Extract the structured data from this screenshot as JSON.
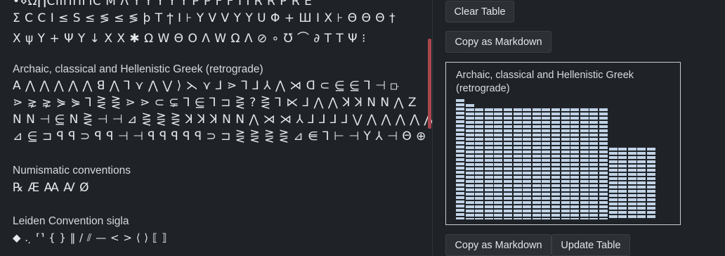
{
  "glyph_lines": [
    "•⋄Ω∏CIIΠΠΓIC M Λ Y Y Y Y Y P P F F I I R R P R E",
    "Σ C Ⅽ I ≤ S ≤ ≶ ≤ ≶ ϸ T ϯ I ⊦ Y V V Y Y U Φ + Ш I X ⊦ Θ Θ Θ †",
    "X ψ Y + Ψ Y ↓ X X ✱ Ω W Θ O Λ W Ω Λ ⊘ ∘ Ʊ ⌒ ∂ T T Ψ ⁝"
  ],
  "sections": [
    {
      "title": "Archaic, classical and Hellenistic Greek (retrograde)",
      "lines": [
        "ꓮ ⋀ ⋀ ⋀ ⋀ ⋀ ꓭ ⋀ ⅂ ⋎ ⋀ ⋁ ⟩ ⋋ ⋎ ⅃ ⋗ ⅂ ⅃ ⅄ ⋀ ⋊ ꓷ ⊂ ⋸ ⋸ ⅂ ⊣ ⟥",
        "⋗ ⋧ ⋧ ⋟ ⋟ ⅂ ⋛ ⋛ ⋗ ⋗ ⊂ ⊊ ⅂ ⋸ ⅂ ⊐ ⋛ ? ⋛ ⅂ ⋉ ⅃ ⋀ ⋀ ꓘ ꓘ ꓠ ꓠ ⋀ Z",
        "ꓠ ꓠ ⊣ ⋸ ꓠ ⋛ ⊣ ⊣ ⊿ ⋛ ⋛ ⋛ ꓘ ꓘ ꓘ ꓠ ꓠ ⋀ ⋊ ⋊ ⅄ ⅃ ⅃ ⅃ ⅃ ⋁ ⋀ ⋀ ⋀ ⋀ ⋀",
        "⊿ ⋸ ⊐ ꟼ ꟼ ⊃ ꟼ ꟼ ⊣ ⊣ ꟼ ꟼ ꟼ ꟼ ꟼ ⊃ ⊐ ⋛ ⋛ ⋛ ⋛ ⊿ ⋹ ⅂ ⊢ ⊣ Y ⅄ ⊣ Θ ⊕"
      ]
    },
    {
      "title": "Numismatic conventions",
      "lines": [
        "℞ Æ Ꜳ Ꜹ Ø"
      ]
    },
    {
      "title": "Leiden Convention sigla",
      "lines": [
        "◆ . ̣ ⸢⸣ { } ‖ / ⫽ — < > ⟨ ⟩ ⟦ ⟧"
      ]
    }
  ],
  "buttons": {
    "clear_table": "Clear Table",
    "copy_markdown_top": "Copy as Markdown",
    "copy_markdown_bottom": "Copy as Markdown",
    "update_table": "Update Table"
  },
  "preview": {
    "title": "Archaic, classical and Hellenistic Greek (retrograde)",
    "bar_levels": [
      0.97,
      0.93,
      0.9,
      0.9,
      0.9,
      0.9,
      0.9,
      0.9,
      0.9,
      0.9,
      0.9,
      0.9,
      0.9,
      0.9,
      0.9,
      0.9,
      0.58,
      0.58,
      0.58,
      0.58,
      0.58
    ]
  },
  "colors": {
    "background": "#1f2328",
    "scrollbar": "#a8474d",
    "bar_fill": "#c2d3e6",
    "accent_diamond": "#d14b3c"
  }
}
